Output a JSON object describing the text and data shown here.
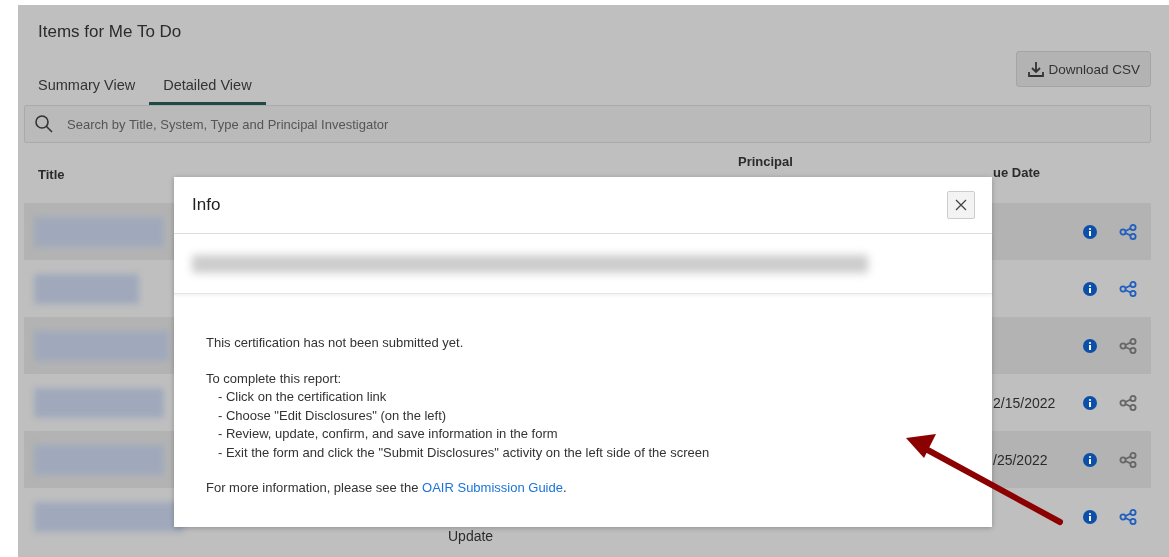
{
  "page": {
    "title": "Items for Me To Do"
  },
  "tabs": [
    {
      "label": "Summary View",
      "selected": false
    },
    {
      "label": "Detailed View",
      "selected": true
    }
  ],
  "download_button": {
    "label": "Download CSV"
  },
  "search": {
    "placeholder": "Search by Title, System, Type and Principal Investigator"
  },
  "table": {
    "columns": [
      "Title",
      "Principal",
      "ue Date"
    ],
    "rows": [
      {
        "share_enabled": true
      },
      {
        "share_enabled": true
      },
      {
        "share_enabled": false
      },
      {
        "due_date": "2/15/2022",
        "share_enabled": false
      },
      {
        "due_date": "/25/2022",
        "share_enabled": false
      },
      {
        "status": "Update",
        "share_enabled": true
      }
    ]
  },
  "modal": {
    "title": "Info",
    "intro": "This certification has not been submitted yet.",
    "steps_heading": "To complete this report:",
    "steps": [
      "- Click on the certification link",
      "- Choose \"Edit Disclosures\" (on the left)",
      "- Review, update, confirm, and save information in the form",
      "- Exit the form and click the \"Submit Disclosures\" activity on the left side of the screen"
    ],
    "footer": {
      "text": "For more information, please see the ",
      "link": "OAIR Submission Guide",
      "after": "."
    }
  }
}
